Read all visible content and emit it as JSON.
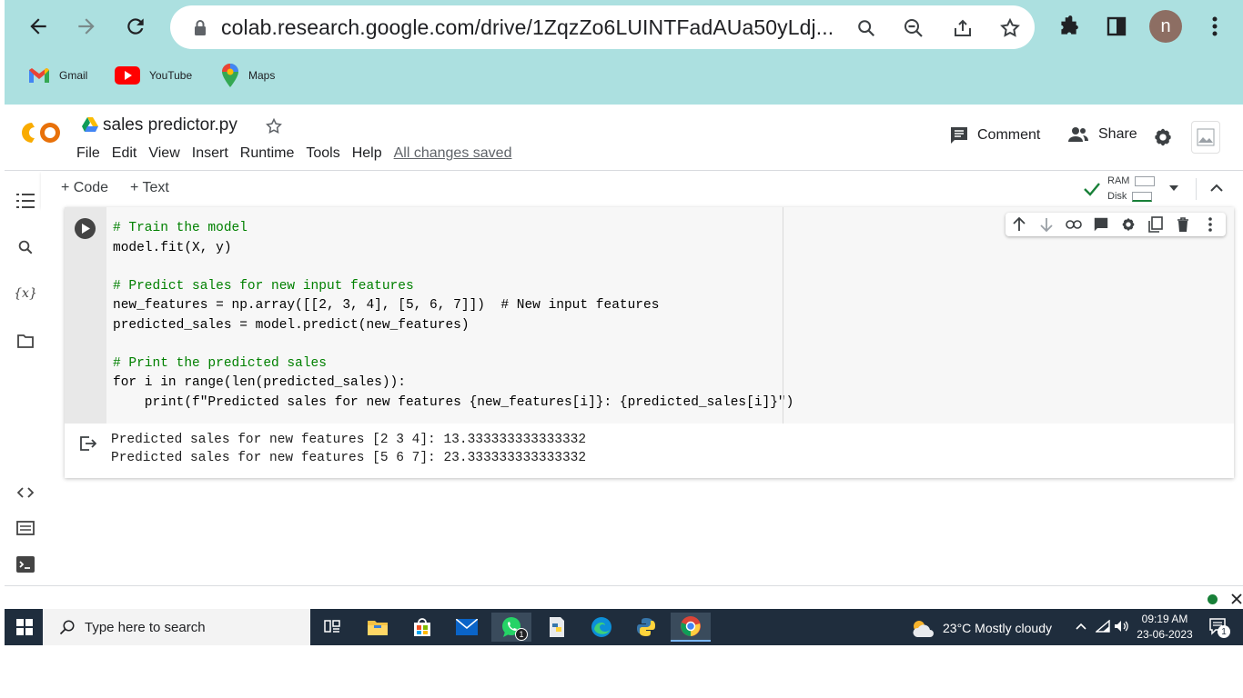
{
  "browser": {
    "url": "colab.research.google.com/drive/1ZqzZo6LUINTFadAUa50yLdj...",
    "profile_initial": "n",
    "bookmarks": [
      {
        "label": "Gmail",
        "icon": "gmail-icon"
      },
      {
        "label": "YouTube",
        "icon": "youtube-icon"
      },
      {
        "label": "Maps",
        "icon": "maps-icon"
      }
    ]
  },
  "colab": {
    "logo_text": "CO",
    "notebook_title": "sales predictor.py",
    "menu": [
      "File",
      "Edit",
      "View",
      "Insert",
      "Runtime",
      "Tools",
      "Help"
    ],
    "save_status": "All changes saved",
    "comment_label": "Comment",
    "share_label": "Share",
    "add_code_label": "+ Code",
    "add_text_label": "+ Text",
    "ram_label": "RAM",
    "disk_label": "Disk"
  },
  "cell": {
    "code_lines": [
      "# Train the model",
      "model.fit(X, y)",
      "",
      "# Predict sales for new input features",
      "new_features = np.array([[2, 3, 4], [5, 6, 7]])  # New input features",
      "predicted_sales = model.predict(new_features)",
      "",
      "# Print the predicted sales",
      "for i in range(len(predicted_sales)):",
      "    print(f\"Predicted sales for new features {new_features[i]}: {predicted_sales[i]}\")"
    ],
    "output_lines": [
      "Predicted sales for new features [2 3 4]: 13.333333333333332",
      "Predicted sales for new features [5 6 7]: 23.333333333333332"
    ]
  },
  "taskbar": {
    "search_placeholder": "Type here to search",
    "weather": "23°C  Mostly cloudy",
    "time": "09:19 AM",
    "date": "23-06-2023",
    "whatsapp_badge": "1",
    "notification_badge": "1"
  },
  "colors": {
    "chrome_bg": "#ace0e0",
    "colab_orange": "#f9ab00",
    "taskbar_bg": "#1f2d3d"
  }
}
